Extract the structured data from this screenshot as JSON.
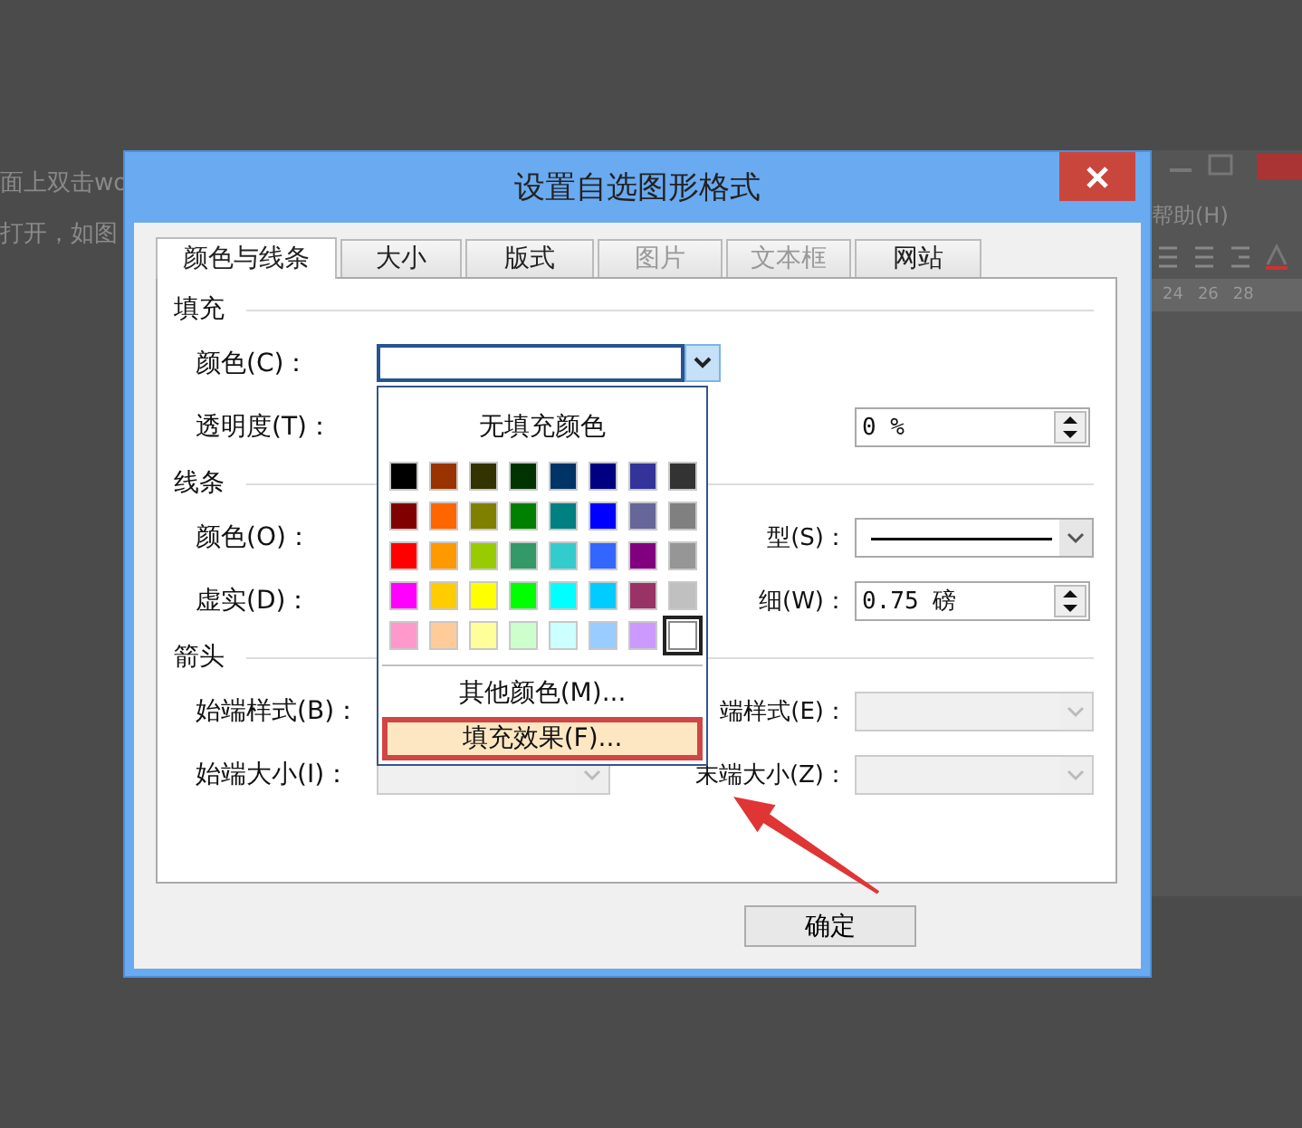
{
  "background": {
    "left_lines": [
      "面上双击wo",
      "打开，如图"
    ],
    "menu": "帮助(H)",
    "ruler": [
      "24",
      "26",
      "28"
    ]
  },
  "dialog": {
    "title": "设置自选图形格式",
    "tabs": [
      {
        "label": "颜色与线条",
        "selected": true,
        "disabled": false
      },
      {
        "label": "大小",
        "selected": false,
        "disabled": false
      },
      {
        "label": "版式",
        "selected": false,
        "disabled": false
      },
      {
        "label": "图片",
        "selected": false,
        "disabled": true
      },
      {
        "label": "文本框",
        "selected": false,
        "disabled": true
      },
      {
        "label": "网站",
        "selected": false,
        "disabled": false
      }
    ],
    "sections": [
      {
        "title": "填充",
        "rows": [
          {
            "label": "颜色(C)：",
            "left": {
              "kind": "color-combo"
            }
          },
          {
            "label": "透明度(T)：",
            "right": {
              "kind": "spin",
              "value": "0 %"
            }
          }
        ]
      },
      {
        "title": "线条",
        "rows": [
          {
            "label": "颜色(O)：",
            "right_label": "型(S)：",
            "right": {
              "kind": "line-dropdown"
            }
          },
          {
            "label": "虚实(D)：",
            "right_label": "细(W)：",
            "right": {
              "kind": "spin",
              "value": "0.75 磅"
            }
          }
        ]
      },
      {
        "title": "箭头",
        "rows": [
          {
            "label": "始端样式(B)：",
            "right_label": "端样式(E)：",
            "right": {
              "kind": "dropdown",
              "disabled": true
            }
          },
          {
            "label": "始端大小(I)：",
            "left": {
              "kind": "dropdown",
              "disabled": true
            },
            "right_label": "末端大小(Z)：",
            "right": {
              "kind": "dropdown",
              "disabled": true
            }
          }
        ]
      }
    ],
    "ok_button": "确定"
  },
  "color_menu": {
    "no_fill": "无填充颜色",
    "swatches": [
      {
        "color": "#000000",
        "selected": false
      },
      {
        "color": "#993300",
        "selected": false
      },
      {
        "color": "#333300",
        "selected": false
      },
      {
        "color": "#003300",
        "selected": false
      },
      {
        "color": "#003366",
        "selected": false
      },
      {
        "color": "#000080",
        "selected": false
      },
      {
        "color": "#333399",
        "selected": false
      },
      {
        "color": "#333333",
        "selected": false
      },
      {
        "color": "#800000",
        "selected": false
      },
      {
        "color": "#ff6600",
        "selected": false
      },
      {
        "color": "#808000",
        "selected": false
      },
      {
        "color": "#008000",
        "selected": false
      },
      {
        "color": "#008080",
        "selected": false
      },
      {
        "color": "#0000ff",
        "selected": false
      },
      {
        "color": "#666699",
        "selected": false
      },
      {
        "color": "#808080",
        "selected": false
      },
      {
        "color": "#ff0000",
        "selected": false
      },
      {
        "color": "#ff9900",
        "selected": false
      },
      {
        "color": "#99cc00",
        "selected": false
      },
      {
        "color": "#339966",
        "selected": false
      },
      {
        "color": "#33cccc",
        "selected": false
      },
      {
        "color": "#3366ff",
        "selected": false
      },
      {
        "color": "#800080",
        "selected": false
      },
      {
        "color": "#969696",
        "selected": false
      },
      {
        "color": "#ff00ff",
        "selected": false
      },
      {
        "color": "#ffcc00",
        "selected": false
      },
      {
        "color": "#ffff00",
        "selected": false
      },
      {
        "color": "#00ff00",
        "selected": false
      },
      {
        "color": "#00ffff",
        "selected": false
      },
      {
        "color": "#00ccff",
        "selected": false
      },
      {
        "color": "#993366",
        "selected": false
      },
      {
        "color": "#c0c0c0",
        "selected": false
      },
      {
        "color": "#ff99cc",
        "selected": false
      },
      {
        "color": "#ffcc99",
        "selected": false
      },
      {
        "color": "#ffff99",
        "selected": false
      },
      {
        "color": "#ccffcc",
        "selected": false
      },
      {
        "color": "#ccffff",
        "selected": false
      },
      {
        "color": "#99ccff",
        "selected": false
      },
      {
        "color": "#cc99ff",
        "selected": false
      },
      {
        "color": "#ffffff",
        "selected": true
      }
    ],
    "items": [
      {
        "label": "其他颜色(M)...",
        "highlighted": false
      },
      {
        "label": "填充效果(F)...",
        "highlighted": true
      }
    ]
  }
}
